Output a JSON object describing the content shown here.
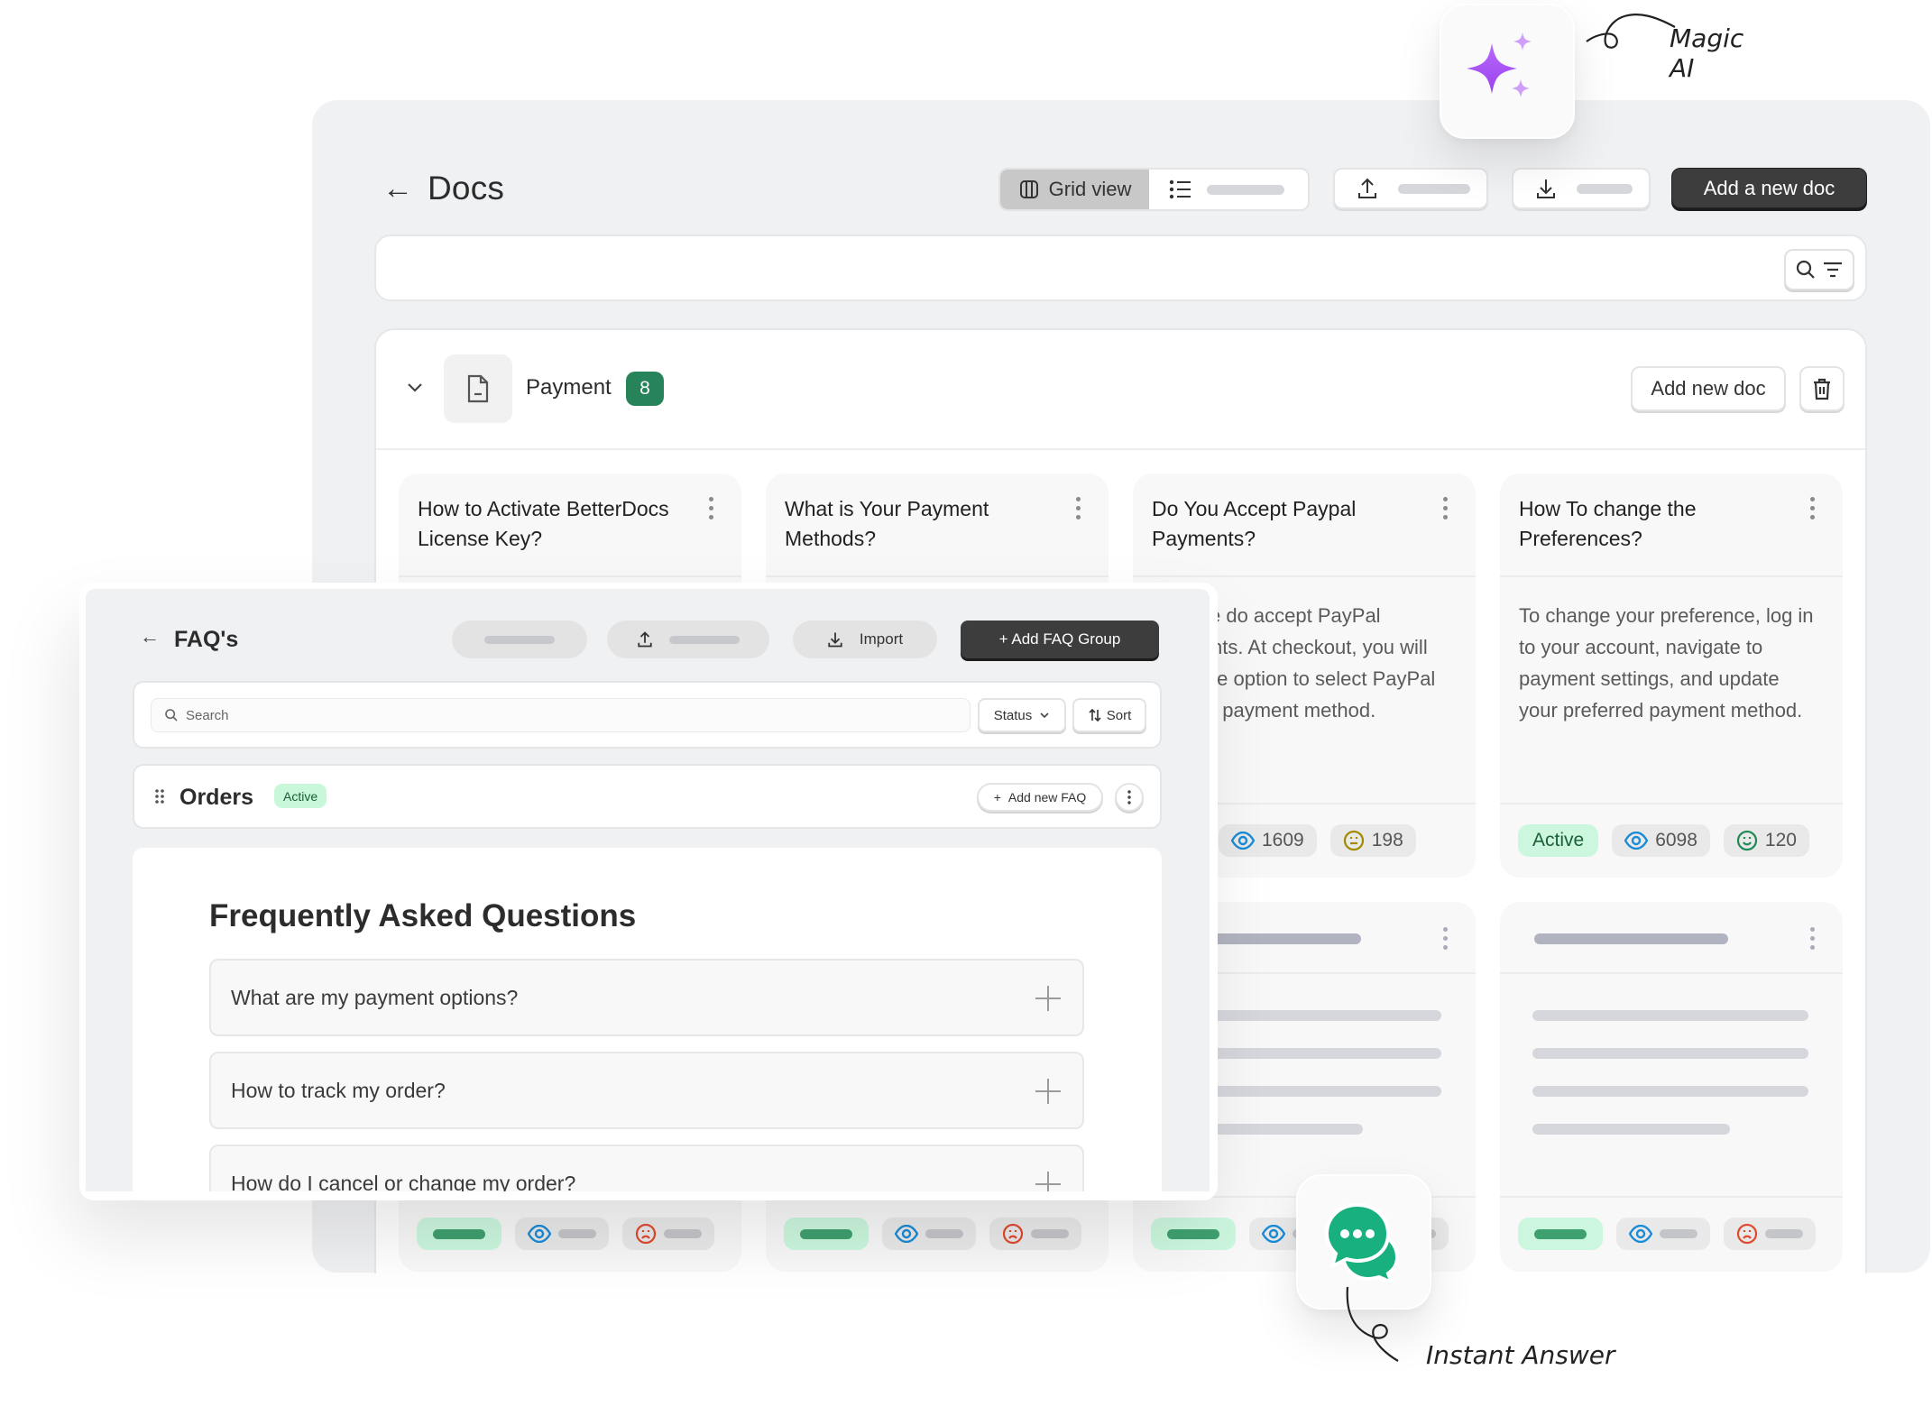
{
  "docs": {
    "title": "Docs",
    "toolbar": {
      "grid_view_label": "Grid view",
      "add_doc_label": "Add a new doc"
    },
    "category": {
      "name": "Payment",
      "count": "8",
      "add_new_doc_label": "Add new doc"
    },
    "cards": [
      {
        "title": "How to Activate BetterDocs License Key?",
        "excerpt": "",
        "status": "",
        "views": "",
        "reactions": ""
      },
      {
        "title": "What is Your Payment Methods?",
        "excerpt": "",
        "status": "",
        "views": "",
        "reactions": ""
      },
      {
        "title": "Do You Accept Paypal Payments?",
        "excerpt": "Yes, we do accept PayPal payments. At checkout, you will have the option to select PayPal as your payment method.",
        "status": "",
        "views": "1609",
        "reactions": "198",
        "reaction_type": "neutral"
      },
      {
        "title": "How To change the Preferences?",
        "excerpt": "To change your preference, log in to your account, navigate to payment settings, and update your preferred payment method.",
        "status": "Active",
        "views": "6098",
        "reactions": "120",
        "reaction_type": "happy"
      }
    ]
  },
  "faq": {
    "title": "FAQ's",
    "import_label": "Import",
    "add_group_label": "+ Add FAQ Group",
    "search_placeholder": "Search",
    "status_label": "Status",
    "sort_label": "Sort",
    "group": {
      "name": "Orders",
      "status": "Active",
      "add_faq_label": "Add new FAQ"
    },
    "preview": {
      "heading": "Frequently Asked Questions",
      "questions": [
        "What are my payment options?",
        "How to track my order?",
        "How do I cancel or change my order?"
      ]
    }
  },
  "callouts": {
    "magic_ai_line1": "Magic",
    "magic_ai_line2": "AI",
    "instant_answer": "Instant Answer"
  },
  "colors": {
    "accent_dark": "#3d3d3d",
    "count_badge": "#27845a",
    "active_badge_bg": "#ccf7de",
    "views_icon": "#1a8bd6",
    "neutral_icon": "#a08a00",
    "happy_icon": "#1f8a55",
    "sad_icon": "#e04a2f",
    "magic_purple": "#a855f7",
    "instant_green": "#17b07e"
  }
}
